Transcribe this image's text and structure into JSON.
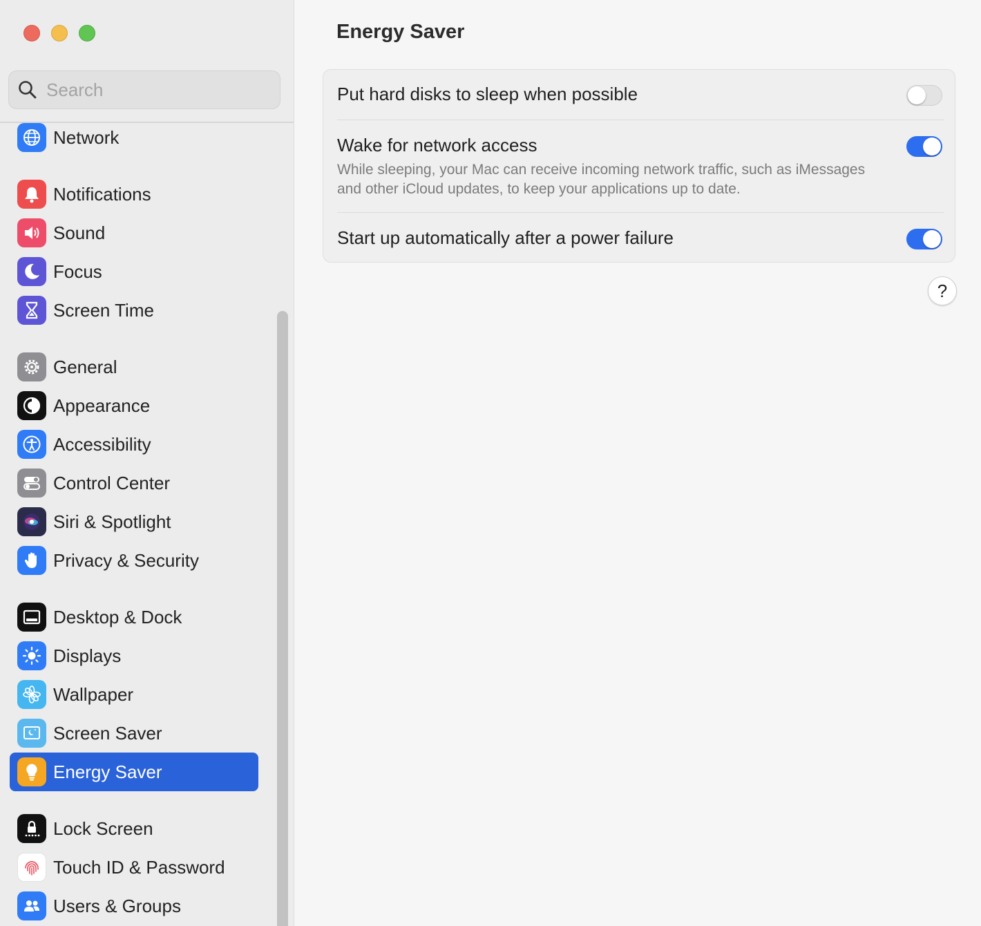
{
  "window": {
    "title": "Energy Saver"
  },
  "search": {
    "placeholder": "Search"
  },
  "sidebar": {
    "items": [
      {
        "label": "Network",
        "icon": "network-globe-icon",
        "color": "#2f7cf6"
      },
      {
        "label": "Notifications",
        "icon": "bell-icon",
        "color": "#ee4d4d"
      },
      {
        "label": "Sound",
        "icon": "speaker-icon",
        "color": "#ee4d6a"
      },
      {
        "label": "Focus",
        "icon": "moon-icon",
        "color": "#5d55d6"
      },
      {
        "label": "Screen Time",
        "icon": "hourglass-icon",
        "color": "#5d55d6"
      },
      {
        "label": "General",
        "icon": "gear-icon",
        "color": "#8e8e93"
      },
      {
        "label": "Appearance",
        "icon": "appearance-icon",
        "color": "#111111"
      },
      {
        "label": "Accessibility",
        "icon": "accessibility-icon",
        "color": "#2f7cf6"
      },
      {
        "label": "Control Center",
        "icon": "switches-icon",
        "color": "#8e8e93"
      },
      {
        "label": "Siri & Spotlight",
        "icon": "siri-icon",
        "color": "#2b2b4a"
      },
      {
        "label": "Privacy & Security",
        "icon": "hand-icon",
        "color": "#2f7cf6"
      },
      {
        "label": "Desktop & Dock",
        "icon": "dock-icon",
        "color": "#111111"
      },
      {
        "label": "Displays",
        "icon": "sun-icon",
        "color": "#2f7cf6"
      },
      {
        "label": "Wallpaper",
        "icon": "flower-icon",
        "color": "#45b6f0"
      },
      {
        "label": "Screen Saver",
        "icon": "screen-saver-icon",
        "color": "#5ab8ee"
      },
      {
        "label": "Energy Saver",
        "icon": "lightbulb-icon",
        "color": "#f5a623"
      },
      {
        "label": "Lock Screen",
        "icon": "lock-icon",
        "color": "#111111"
      },
      {
        "label": "Touch ID & Password",
        "icon": "fingerprint-icon",
        "color": "#ffffff"
      },
      {
        "label": "Users & Groups",
        "icon": "users-icon",
        "color": "#2f7cf6"
      }
    ],
    "selected": "Energy Saver"
  },
  "main": {
    "title": "Energy Saver",
    "settings": [
      {
        "label": "Put hard disks to sleep when possible",
        "enabled": false
      },
      {
        "label": "Wake for network access",
        "description": "While sleeping, your Mac can receive incoming network traffic, such as iMessages and other iCloud updates, to keep your applications up to date.",
        "enabled": true
      },
      {
        "label": "Start up automatically after a power failure",
        "enabled": true
      }
    ],
    "help_label": "?"
  },
  "colors": {
    "accent": "#2962d9",
    "toggle_on": "#2d6ef0"
  }
}
